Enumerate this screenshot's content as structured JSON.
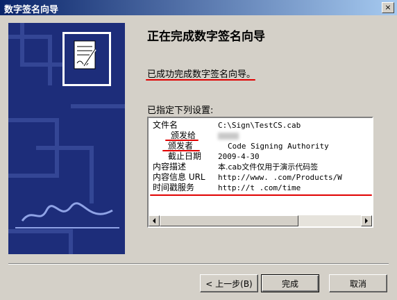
{
  "window": {
    "title": "数字签名向导",
    "close_glyph": "×"
  },
  "content": {
    "heading": "正在完成数字签名向导",
    "success_message": "已成功完成数字签名向导。",
    "settings_label": "已指定下列设置:"
  },
  "settings": [
    {
      "key": "文件名",
      "value": "C:\\Sign\\TestCS.cab"
    },
    {
      "key": "颁发给",
      "value": ""
    },
    {
      "key": "颁发者",
      "value": "Code Signing Authority"
    },
    {
      "key": "截止日期",
      "value": "2009-4-30"
    },
    {
      "key": "内容描述",
      "value": "本.cab文件仅用于演示代码签"
    },
    {
      "key": "内容信息 URL",
      "value": "http://www.    .com/Products/W"
    },
    {
      "key": "时间戳服务",
      "value": "http://t          .com/time"
    }
  ],
  "buttons": {
    "back": "< 上一步(B)",
    "finish": "完成",
    "cancel": "取消"
  },
  "colors": {
    "annotation_red": "#e00000",
    "title_bar": "#0a246a",
    "side_panel": "#1d2d7a"
  }
}
